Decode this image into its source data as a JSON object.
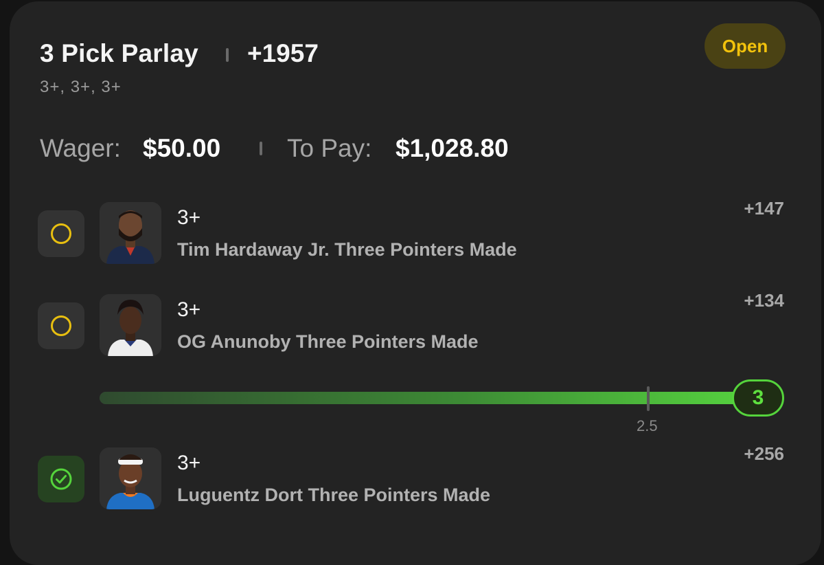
{
  "header": {
    "title": "3 Pick Parlay",
    "odds": "+1957",
    "subtitle": "3+, 3+, 3+",
    "status": "Open"
  },
  "bet": {
    "wager_label": "Wager:",
    "wager_value": "$50.00",
    "topay_label": "To Pay:",
    "topay_value": "$1,028.80"
  },
  "picks": [
    {
      "line": "3+",
      "description": "Tim Hardaway Jr. Three Pointers Made",
      "odds": "+147",
      "status": "pending"
    },
    {
      "line": "3+",
      "description": "OG Anunoby Three Pointers Made",
      "odds": "+134",
      "status": "pending"
    },
    {
      "line": "3+",
      "description": "Luguentz Dort Three Pointers Made",
      "odds": "+256",
      "status": "won"
    }
  ],
  "progress": {
    "current": "3",
    "threshold_label": "2.5",
    "fill_fraction": 1.0
  },
  "colors": {
    "pending": "#e8bf10",
    "won": "#55d43c",
    "open_badge_bg": "#4a4214"
  }
}
